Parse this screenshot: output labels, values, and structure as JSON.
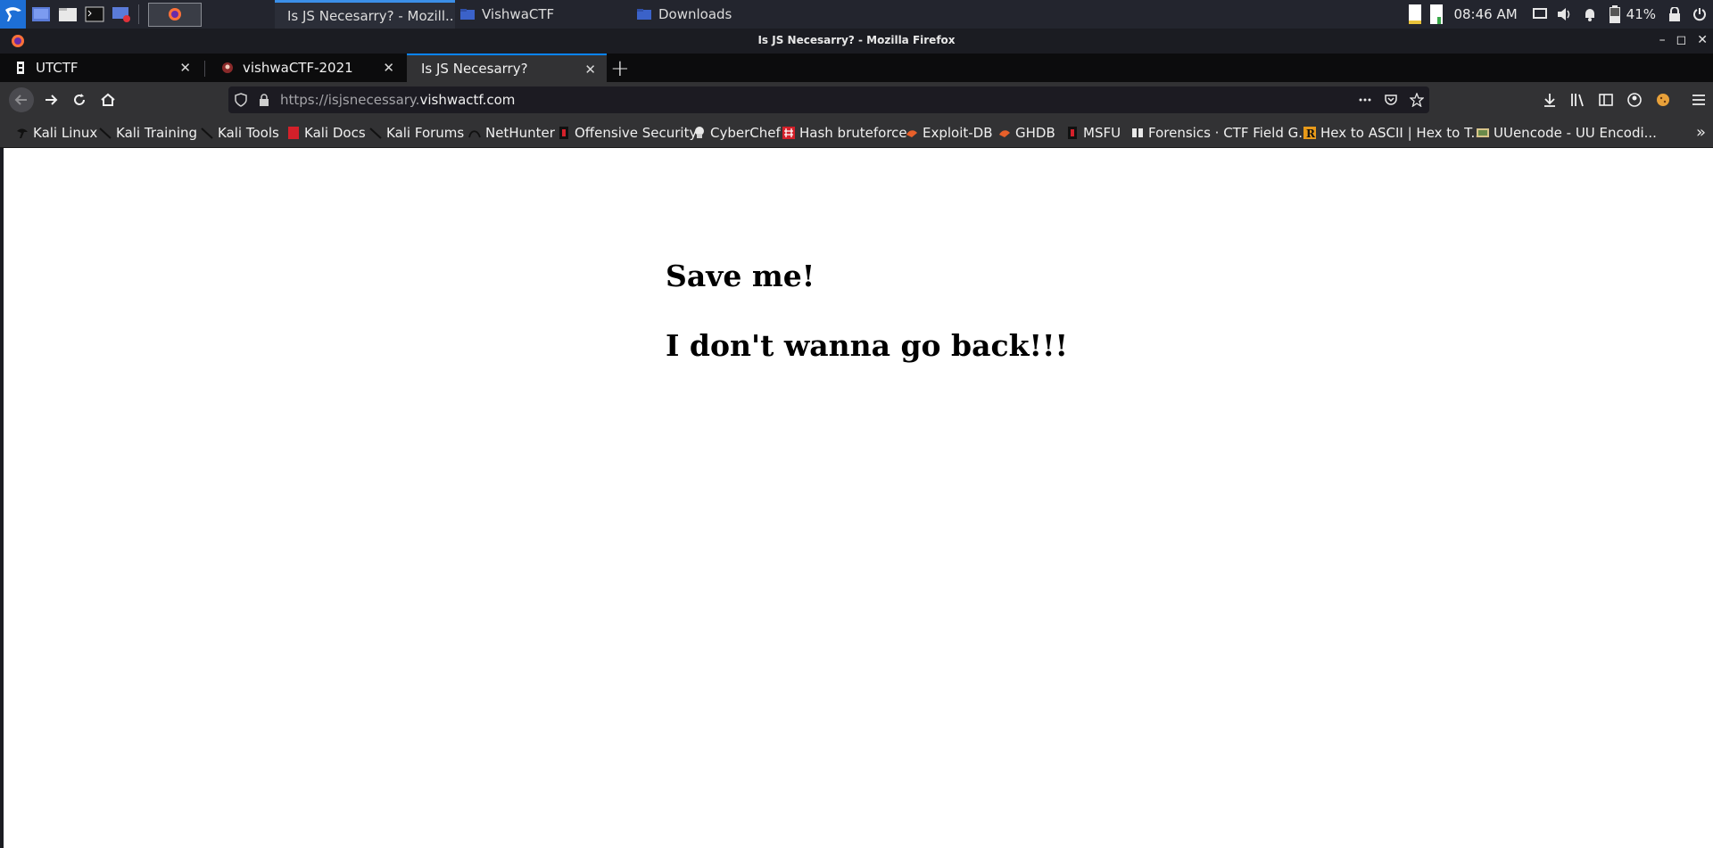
{
  "taskbar": {
    "tasks": [
      {
        "label": "Is JS Necesarry? - Mozill..."
      },
      {
        "label": "VishwaCTF"
      },
      {
        "label": "Downloads"
      }
    ],
    "clock": "08:46 AM",
    "battery": "41%"
  },
  "window": {
    "title": "Is JS Necesarry? - Mozilla Firefox"
  },
  "tabs": [
    {
      "label": "UTCTF",
      "close": "✕"
    },
    {
      "label": "vishwaCTF-2021",
      "close": "✕"
    },
    {
      "label": "Is JS Necesarry?",
      "close": "✕"
    }
  ],
  "newtab": "+",
  "urlbar": {
    "prefix": "https://isjsnecessary.",
    "domain": "vishwactf.com"
  },
  "bookmarks": [
    {
      "label": "Kali Linux"
    },
    {
      "label": "Kali Training"
    },
    {
      "label": "Kali Tools"
    },
    {
      "label": "Kali Docs"
    },
    {
      "label": "Kali Forums"
    },
    {
      "label": "NetHunter"
    },
    {
      "label": "Offensive Security"
    },
    {
      "label": "CyberChef"
    },
    {
      "label": "Hash bruteforce"
    },
    {
      "label": "Exploit-DB"
    },
    {
      "label": "GHDB"
    },
    {
      "label": "MSFU"
    },
    {
      "label": "Forensics · CTF Field G..."
    },
    {
      "label": "Hex to ASCII | Hex to T..."
    },
    {
      "label": "UUencode - UU Encodi..."
    }
  ],
  "page": {
    "heading1": "Save me!",
    "heading2": "I don't wanna go back!!!"
  },
  "colors": {
    "accent": "#0a84ff",
    "kali_blue": "#1d6fd6",
    "toolbar": "#323234",
    "tabstrip": "#0c0c0d"
  }
}
